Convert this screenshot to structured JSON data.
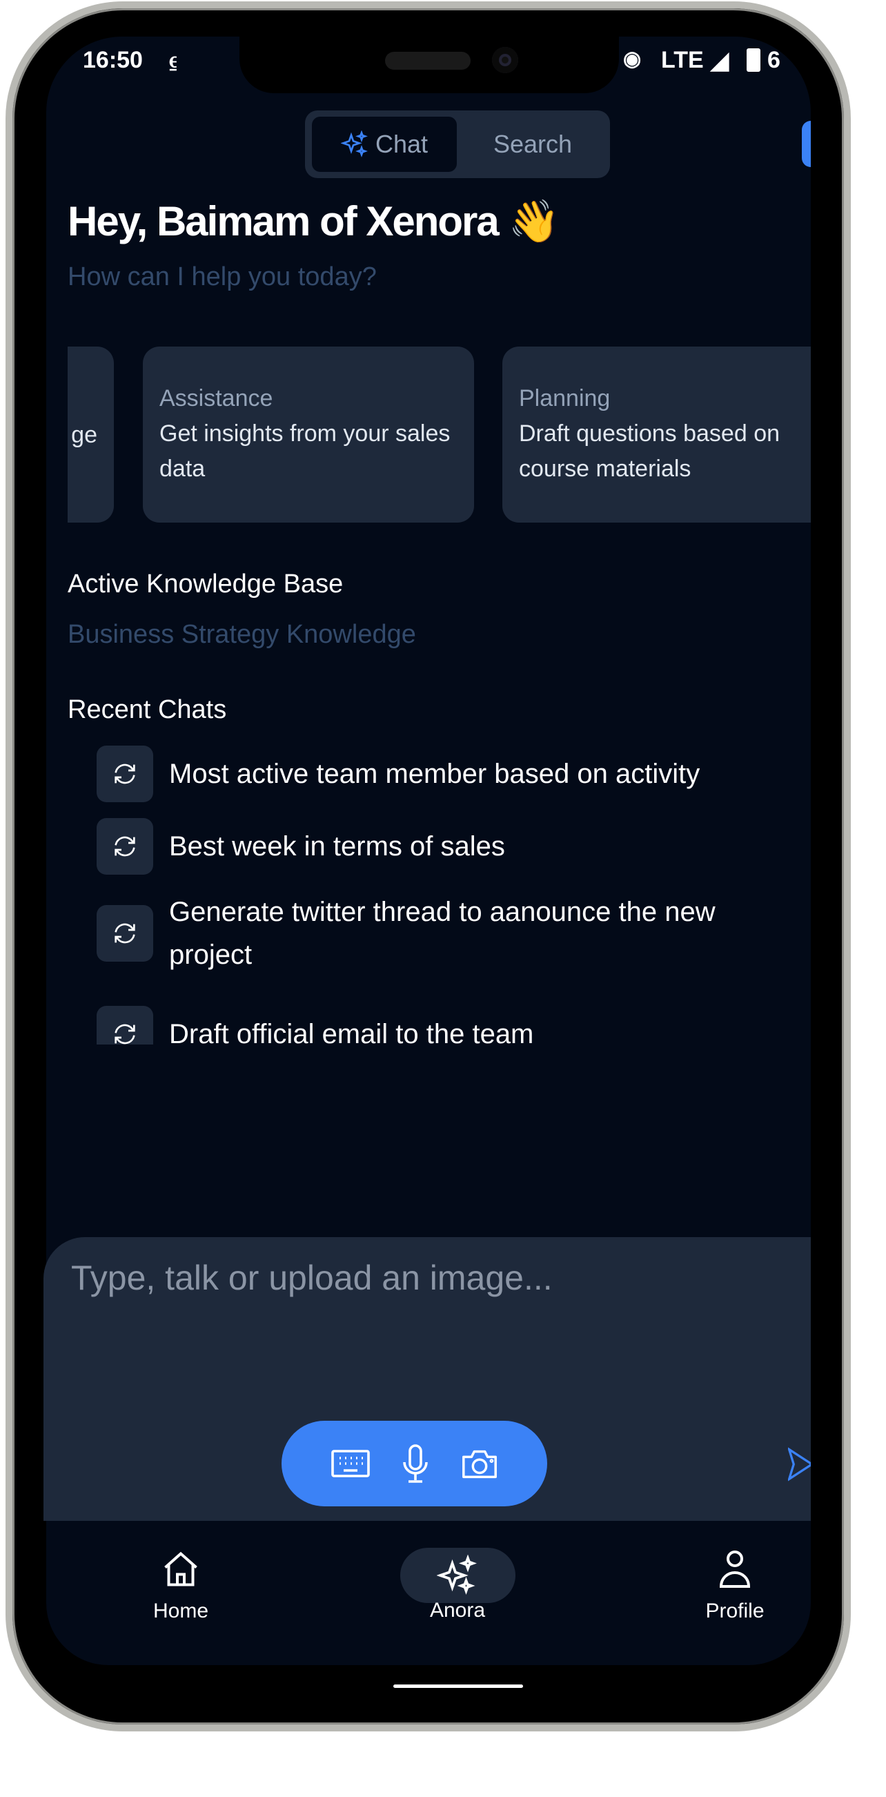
{
  "status_bar": {
    "time": "16:50",
    "network": "LTE",
    "battery": "6"
  },
  "mode_toggle": {
    "chat": "Chat",
    "search": "Search",
    "active": "Chat"
  },
  "greeting": {
    "title": "Hey, Baimam of Xenora",
    "emoji": "👋",
    "subtitle": "How can I help you today?"
  },
  "cards": [
    {
      "label": "",
      "text": "ge"
    },
    {
      "label": "Assistance",
      "text": "Get insights from your sales data"
    },
    {
      "label": "Planning",
      "text": "Draft questions based on course materials"
    }
  ],
  "knowledge_base": {
    "label": "Active Knowledge Base",
    "value": "Business Strategy Knowledge"
  },
  "recent_chats": {
    "label": "Recent Chats",
    "items": [
      "Most active team member based on activity",
      "Best week in terms of sales",
      "Generate twitter thread to aanounce the new project",
      "Draft official email to the team"
    ]
  },
  "composer": {
    "placeholder": "Type, talk or upload an image..."
  },
  "nav": [
    {
      "label": "Home",
      "icon": "home-icon"
    },
    {
      "label": "Anora",
      "icon": "sparkles-icon",
      "active": true
    },
    {
      "label": "Profile",
      "icon": "user-icon"
    }
  ],
  "colors": {
    "accent": "#3b82f6",
    "background": "#030a18",
    "surface": "#1e293b"
  }
}
